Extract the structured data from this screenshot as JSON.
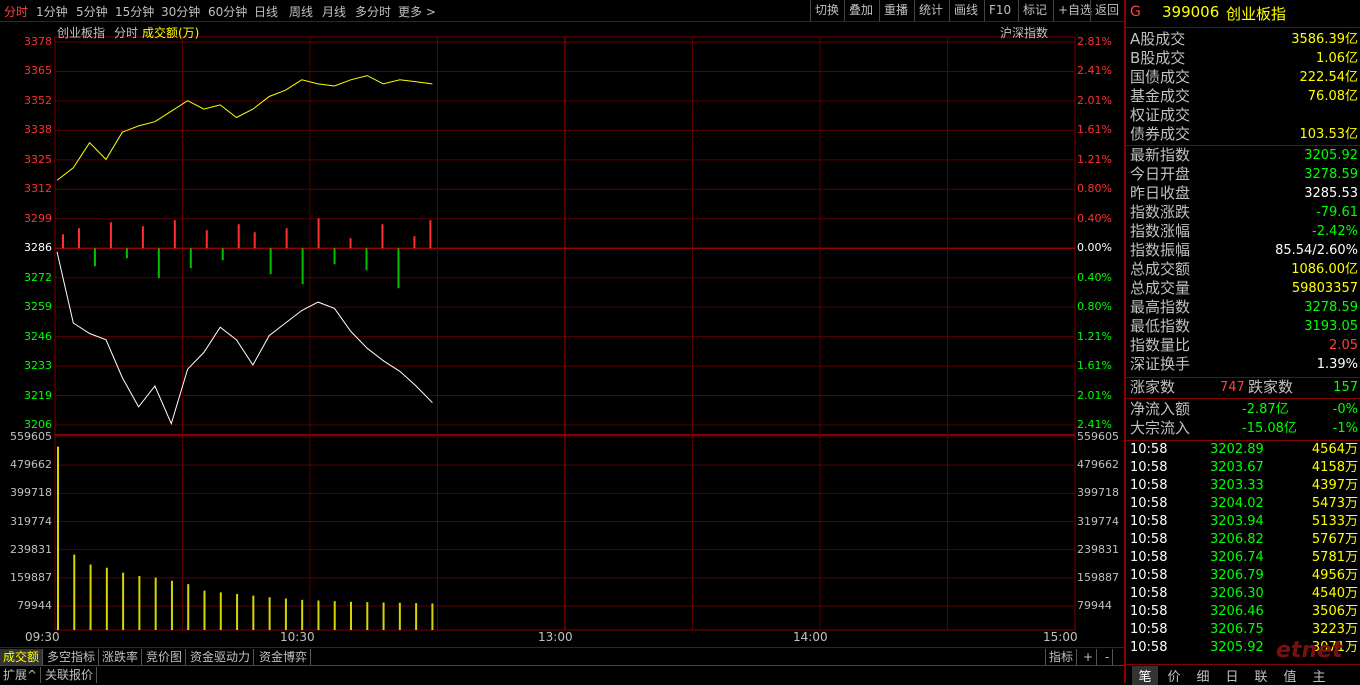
{
  "toolbar": {
    "periods": [
      "分时",
      "1分钟",
      "5分钟",
      "15分钟",
      "30分钟",
      "60分钟",
      "日线",
      "周线",
      "月线",
      "多分时",
      "更多 >"
    ],
    "right_items": [
      "切换",
      "叠加",
      "重播",
      "统计",
      "画线",
      "F10",
      "标记",
      "+自选",
      "返回"
    ]
  },
  "chart": {
    "title_index": "创业板指",
    "title_mode": "分时",
    "title_vol": "成交额(万)",
    "compare_label": "沪深指数",
    "price_labels": [
      "3378",
      "3365",
      "3352",
      "3338",
      "3325",
      "3312",
      "3299",
      "3286",
      "3272",
      "3259",
      "3246",
      "3233",
      "3219",
      "3206"
    ],
    "pct_labels": [
      "2.81%",
      "2.41%",
      "2.01%",
      "1.61%",
      "1.21%",
      "0.80%",
      "0.40%",
      "0.00%",
      "0.40%",
      "0.80%",
      "1.21%",
      "1.61%",
      "2.01%",
      "2.41%"
    ],
    "volume_labels": [
      "559605",
      "479662",
      "399718",
      "319774",
      "239831",
      "159887",
      "79944"
    ],
    "time_labels": [
      "09:30",
      "10:30",
      "13:00",
      "14:00",
      "15:00"
    ]
  },
  "chart_data": {
    "type": "line",
    "x_start": "09:30",
    "x_end": "15:00",
    "ylim": [
      3193,
      3378
    ],
    "series": [
      {
        "name": "沪深指数",
        "values": [
          3312,
          3318,
          3330,
          3322,
          3335,
          3338,
          3340,
          3345,
          3350,
          3346,
          3348,
          3342,
          3346,
          3352,
          3355,
          3360,
          3358,
          3357,
          3360,
          3362,
          3358,
          3360,
          3359,
          3358
        ]
      },
      {
        "name": "创业板指",
        "values": [
          3278,
          3244,
          3239,
          3236,
          3218,
          3204,
          3214,
          3196,
          3222,
          3230,
          3242,
          3236,
          3224,
          3238,
          3244,
          3250,
          3254,
          3251,
          3240,
          3232,
          3226,
          3221,
          3214,
          3206
        ]
      }
    ],
    "volume": [
      559605,
      230000,
      200000,
      190000,
      175000,
      165000,
      160000,
      150000,
      140000,
      120000,
      115000,
      110000,
      105000,
      100000,
      96000,
      92000,
      90000,
      88000,
      86000,
      85000,
      84000,
      83000,
      82000,
      81000
    ]
  },
  "bottom_tabs": [
    "成交额",
    "多空指标",
    "涨跌率",
    "竞价图",
    "资金驱动力",
    "资金博弈"
  ],
  "bottom_right": [
    "指标",
    "+",
    "-"
  ],
  "bottom_bar": [
    "扩展^",
    "关联报价"
  ],
  "panel": {
    "code_prefix": "G",
    "code": "399006",
    "name": "创业板指",
    "block1": [
      {
        "label": "A股成交",
        "value": "3586.39亿"
      },
      {
        "label": "B股成交",
        "value": "1.06亿"
      },
      {
        "label": "国债成交",
        "value": "222.54亿"
      },
      {
        "label": "基金成交",
        "value": "76.08亿"
      },
      {
        "label": "权证成交",
        "value": ""
      },
      {
        "label": "债券成交",
        "value": "103.53亿"
      }
    ],
    "block2": [
      {
        "label": "最新指数",
        "value": "3205.92",
        "color": "#00ff00"
      },
      {
        "label": "今日开盘",
        "value": "3278.59",
        "color": "#00ff00"
      },
      {
        "label": "昨日收盘",
        "value": "3285.53",
        "color": "#ffffff"
      },
      {
        "label": "指数涨跌",
        "value": "-79.61",
        "color": "#00ff00"
      },
      {
        "label": "指数涨幅",
        "value": "-2.42%",
        "color": "#00ff00"
      },
      {
        "label": "指数振幅",
        "value": "85.54/2.60%",
        "color": "#ffffff"
      },
      {
        "label": "总成交额",
        "value": "1086.00亿",
        "color": "#ffff00"
      },
      {
        "label": "总成交量",
        "value": "59803357",
        "color": "#ffff00"
      },
      {
        "label": "最高指数",
        "value": "3278.59",
        "color": "#00ff00"
      },
      {
        "label": "最低指数",
        "value": "3193.05",
        "color": "#00ff00"
      },
      {
        "label": "指数量比",
        "value": "2.05",
        "color": "#ff4040"
      },
      {
        "label": "深证换手",
        "value": "1.39%",
        "color": "#ffffff"
      }
    ],
    "updown": {
      "up_label": "涨家数",
      "up_value": "747",
      "down_label": "跌家数",
      "down_value": "157"
    },
    "flows": [
      {
        "label": "净流入额",
        "value": "-2.87亿",
        "pct": "-0%"
      },
      {
        "label": "大宗流入",
        "value": "-15.08亿",
        "pct": "-1%"
      }
    ],
    "ticks": [
      {
        "time": "10:58",
        "price": "3202.89",
        "vol": "4564万"
      },
      {
        "time": "10:58",
        "price": "3203.67",
        "vol": "4158万"
      },
      {
        "time": "10:58",
        "price": "3203.33",
        "vol": "4397万"
      },
      {
        "time": "10:58",
        "price": "3204.02",
        "vol": "5473万"
      },
      {
        "time": "10:58",
        "price": "3203.94",
        "vol": "5133万"
      },
      {
        "time": "10:58",
        "price": "3206.82",
        "vol": "5767万"
      },
      {
        "time": "10:58",
        "price": "3206.74",
        "vol": "5781万"
      },
      {
        "time": "10:58",
        "price": "3206.79",
        "vol": "4956万"
      },
      {
        "time": "10:58",
        "price": "3206.30",
        "vol": "4540万"
      },
      {
        "time": "10:58",
        "price": "3206.46",
        "vol": "3506万"
      },
      {
        "time": "10:58",
        "price": "3206.75",
        "vol": "3223万"
      },
      {
        "time": "10:58",
        "price": "3205.92",
        "vol": "3071万"
      }
    ],
    "bottom_tabs": [
      "笔",
      "价",
      "细",
      "日",
      "联",
      "值",
      "主"
    ],
    "watermark": "etnet"
  }
}
